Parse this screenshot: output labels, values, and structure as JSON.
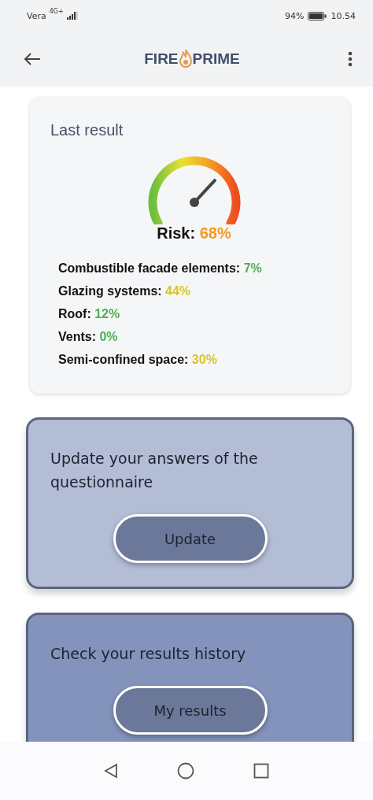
{
  "status_bar": {
    "carrier": "Vera",
    "network": "4G+",
    "battery": "94%",
    "time": "10.54"
  },
  "app_bar": {
    "logo_left": "FIRE",
    "logo_right": "PRIME"
  },
  "last_result": {
    "title": "Last result",
    "risk": {
      "label": "Risk:",
      "value": "68%",
      "color": "#f39a1e"
    },
    "factors": [
      {
        "label": "Combustible facade elements:",
        "value": "7%",
        "color": "#4caf50"
      },
      {
        "label": "Glazing systems:",
        "value": "44%",
        "color": "#d6c52c"
      },
      {
        "label": "Roof:",
        "value": "12%",
        "color": "#4caf50"
      },
      {
        "label": "Vents:",
        "value": "0%",
        "color": "#4caf50"
      },
      {
        "label": "Semi-confined space:",
        "value": "30%",
        "color": "#d6c52c"
      }
    ]
  },
  "actions": [
    {
      "text": "Update your answers of the questionnaire",
      "button": "Update",
      "color": "#b3bdd6"
    },
    {
      "text": "Check your results history",
      "button": "My results",
      "color": "#8393bb"
    }
  ]
}
